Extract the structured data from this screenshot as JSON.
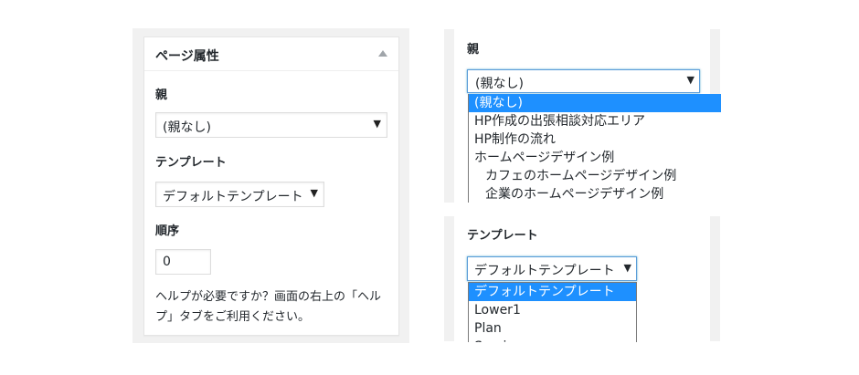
{
  "left": {
    "box_title": "ページ属性",
    "parent_label": "親",
    "parent_value": "(親なし)",
    "template_label": "テンプレート",
    "template_value": "デフォルトテンプレート",
    "order_label": "順序",
    "order_value": "0",
    "help_text": "ヘルプが必要ですか？画面の右上の「ヘルプ」タブをご利用ください。"
  },
  "right_top": {
    "parent_label": "親",
    "select_value": "(親なし)",
    "options": [
      {
        "label": "(親なし)",
        "selected": true,
        "child": false
      },
      {
        "label": "HP作成の出張相談対応エリア",
        "selected": false,
        "child": false
      },
      {
        "label": "HP制作の流れ",
        "selected": false,
        "child": false
      },
      {
        "label": "ホームページデザイン例",
        "selected": false,
        "child": false
      },
      {
        "label": "カフェのホームページデザイン例",
        "selected": false,
        "child": true
      },
      {
        "label": "企業のホームページデザイン例",
        "selected": false,
        "child": true
      }
    ]
  },
  "right_bottom": {
    "template_label": "テンプレート",
    "select_value": "デフォルトテンプレート",
    "options": [
      {
        "label": "デフォルトテンプレート",
        "selected": true
      },
      {
        "label": "Lower1",
        "selected": false
      },
      {
        "label": "Plan",
        "selected": false
      },
      {
        "label": "Service",
        "selected": false
      }
    ]
  },
  "icons": {
    "collapse": "triangle-up-icon",
    "dropdown": "caret-down-icon"
  },
  "colors": {
    "highlight": "#1e90ff",
    "focus_border": "#5b9dd9"
  }
}
